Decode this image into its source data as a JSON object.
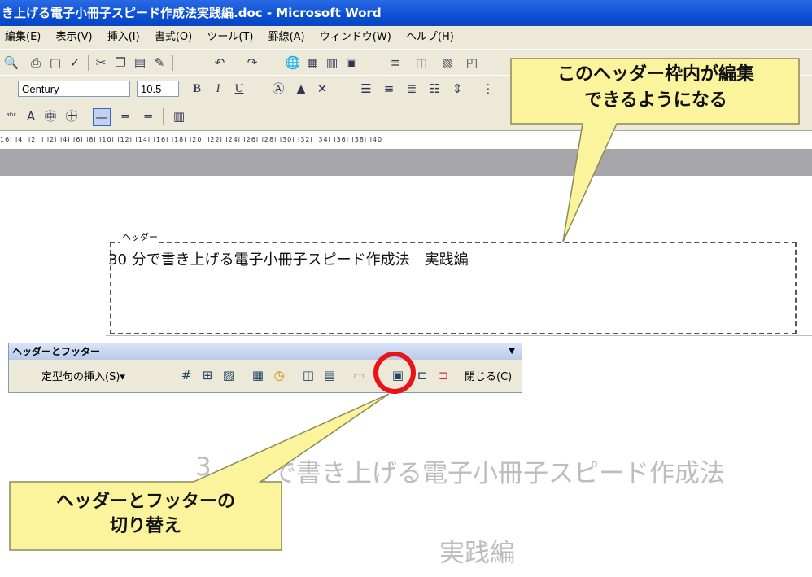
{
  "window": {
    "title": "き上げる電子小冊子スピード作成法実践編.doc - Microsoft Word"
  },
  "menu": [
    "編集(E)",
    "表示(V)",
    "挿入(I)",
    "書式(O)",
    "ツール(T)",
    "罫線(A)",
    "ウィンドウ(W)",
    "ヘルプ(H)"
  ],
  "format_toolbar": {
    "font_name": "Century",
    "font_size": "10.5",
    "bold": "B",
    "italic": "I",
    "underline": "U"
  },
  "ruler": {
    "ticks": "16l l4l l2l l l2l l4l l6l l8l l10l l12l l14l l16l l18l l20l l22l l24l l26l l28l l30l l32l l34l l36l l38l l40"
  },
  "document": {
    "header_label": "ヘッダー",
    "header_text": "30 分で書き上げる電子小冊子スピード作成法　実践編",
    "ghost_title_left": "3",
    "ghost_title_right": "分で書き上げる電子小冊子スピード作成法",
    "ghost_subtitle": "実践編"
  },
  "hf_toolbar": {
    "title": "ヘッダーとフッター",
    "insert_autotext": "定型句の挿入(S)▾",
    "close": "閉じる(C)"
  },
  "callouts": {
    "top_line1": "このヘッダー枠内が編集",
    "top_line2": "できるようになる",
    "bottom_line1": "ヘッダーとフッターの",
    "bottom_line2": "切り替え",
    "fill_color": "#fbf49c"
  }
}
